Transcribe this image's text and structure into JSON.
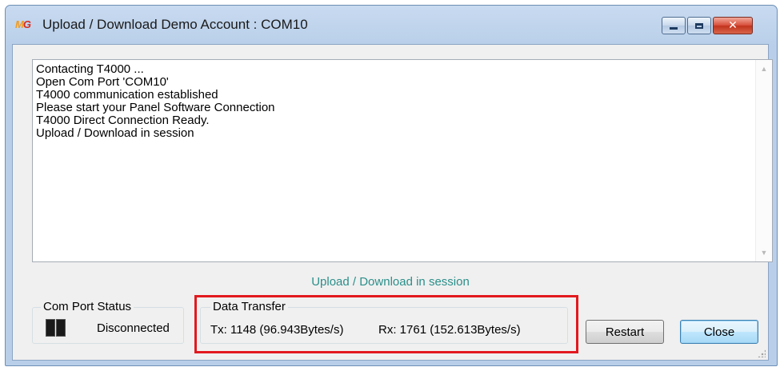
{
  "window": {
    "icon_text": "MG",
    "title": "Upload / Download Demo Account : COM10"
  },
  "log": {
    "lines": [
      "Contacting T4000 ...",
      "Open Com Port 'COM10'",
      "T4000 communication established",
      "Please start your Panel Software Connection",
      "T4000 Direct Connection Ready.",
      "Upload / Download in session"
    ]
  },
  "session_status": "Upload / Download in session",
  "com_port": {
    "legend": "Com Port Status",
    "status": "Disconnected"
  },
  "data_transfer": {
    "legend": "Data Transfer",
    "tx": "Tx: 1148 (96.943Bytes/s)",
    "rx": "Rx: 1761 (152.613Bytes/s)"
  },
  "buttons": {
    "restart": "Restart",
    "close": "Close"
  },
  "colors": {
    "status_text": "#2b8f8a",
    "highlight": "#e2191e"
  }
}
